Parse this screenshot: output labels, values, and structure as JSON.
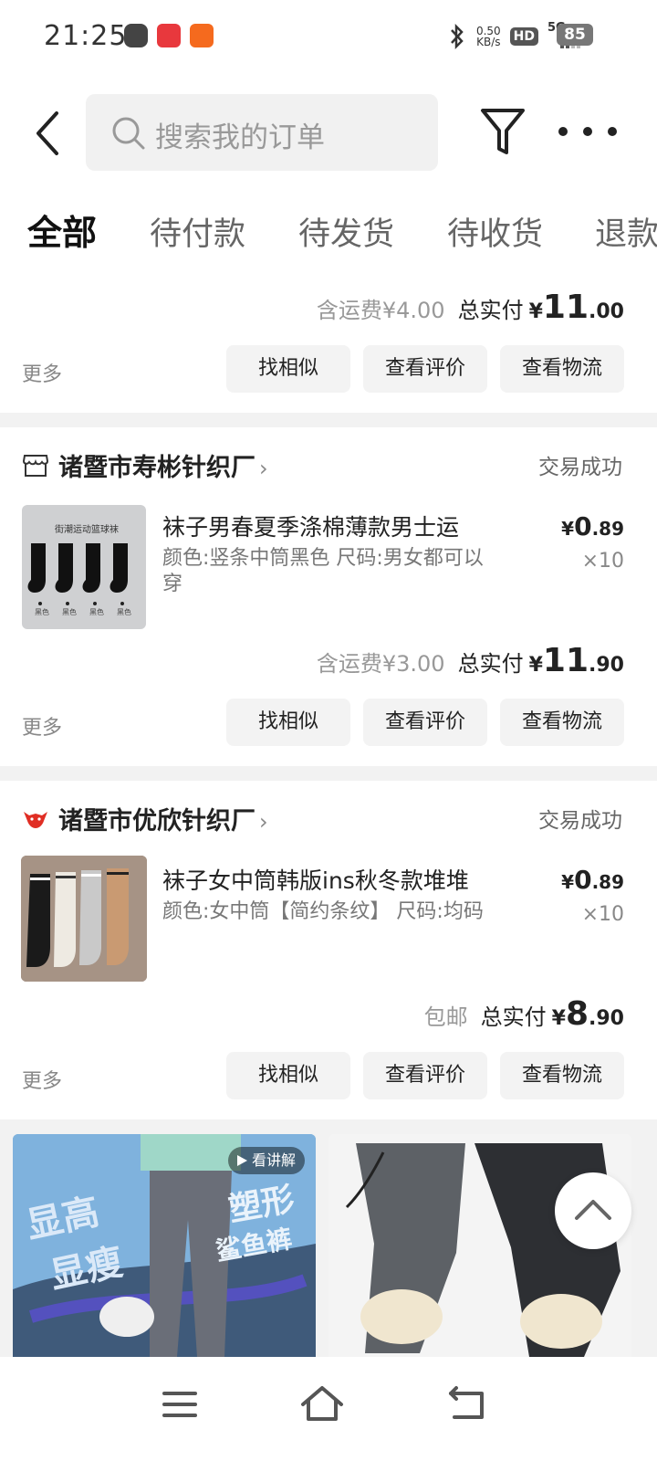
{
  "status_bar": {
    "time": "21:25",
    "net_speed_value": "0.50",
    "net_speed_unit": "KB/s",
    "hd": "HD",
    "signal": "5G",
    "battery": "85"
  },
  "header": {
    "search_placeholder": "搜索我的订单"
  },
  "tabs": [
    "全部",
    "待付款",
    "待发货",
    "待收货",
    "退款"
  ],
  "common": {
    "more_label": "更多",
    "btn_similar": "找相似",
    "btn_review": "查看评价",
    "btn_logistics": "查看物流",
    "total_label": "总实付",
    "yen": "¥",
    "status_success": "交易成功"
  },
  "orders": [
    {
      "shipping": "含运费¥4.00",
      "total_int": "11",
      "total_dec": ".00"
    },
    {
      "shop": "诸暨市寿彬针织厂",
      "title": "袜子男春夏季涤棉薄款男士运",
      "spec": "颜色:竖条中筒黑色 尺码:男女都可以穿",
      "price_int": "0",
      "price_dec": ".89",
      "qty": "×10",
      "shipping": "含运费¥3.00",
      "total_int": "11",
      "total_dec": ".90",
      "img_caption": "街潮运动篮球袜",
      "sock_labels": [
        "黑色",
        "黑色",
        "黑色",
        "黑色"
      ]
    },
    {
      "shop": "诸暨市优欣针织厂",
      "title": "袜子女中筒韩版ins秋冬款堆堆",
      "spec": "颜色:女中筒【简约条纹】 尺码:均码",
      "price_int": "0",
      "price_dec": ".89",
      "qty": "×10",
      "shipping": "包邮",
      "total_int": "8",
      "total_dec": ".90"
    }
  ],
  "recommend": {
    "video_badge": "看讲解",
    "left_text_1": "显高",
    "left_text_2": "显瘦",
    "left_text_3": "塑形",
    "left_text_4": "鲨鱼裤"
  },
  "colors": {
    "accent_red": "#e02e24",
    "tab_active": "#111111"
  }
}
